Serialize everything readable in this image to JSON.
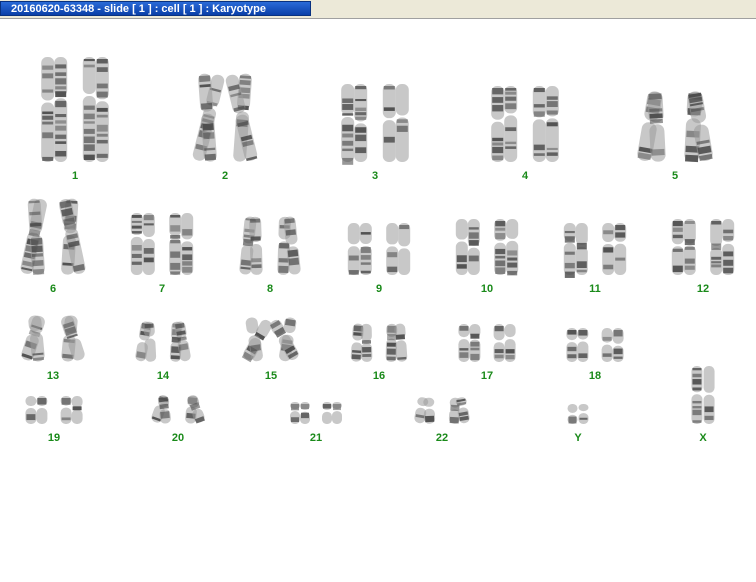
{
  "window": {
    "title": "20160620-63348 - slide [ 1 ] : cell [ 1 ] : Karyotype"
  },
  "karyotype": {
    "chromosomes": [
      {
        "label": "1"
      },
      {
        "label": "2"
      },
      {
        "label": "3"
      },
      {
        "label": "4"
      },
      {
        "label": "5"
      },
      {
        "label": "6"
      },
      {
        "label": "7"
      },
      {
        "label": "8"
      },
      {
        "label": "9"
      },
      {
        "label": "10"
      },
      {
        "label": "11"
      },
      {
        "label": "12"
      },
      {
        "label": "13"
      },
      {
        "label": "14"
      },
      {
        "label": "15"
      },
      {
        "label": "16"
      },
      {
        "label": "17"
      },
      {
        "label": "18"
      },
      {
        "label": "19"
      },
      {
        "label": "20"
      },
      {
        "label": "21"
      },
      {
        "label": "22"
      },
      {
        "label": "Y"
      },
      {
        "label": "X"
      }
    ],
    "label_color": "#1a8a1a",
    "chromatin_color": "#4a4a4a"
  }
}
